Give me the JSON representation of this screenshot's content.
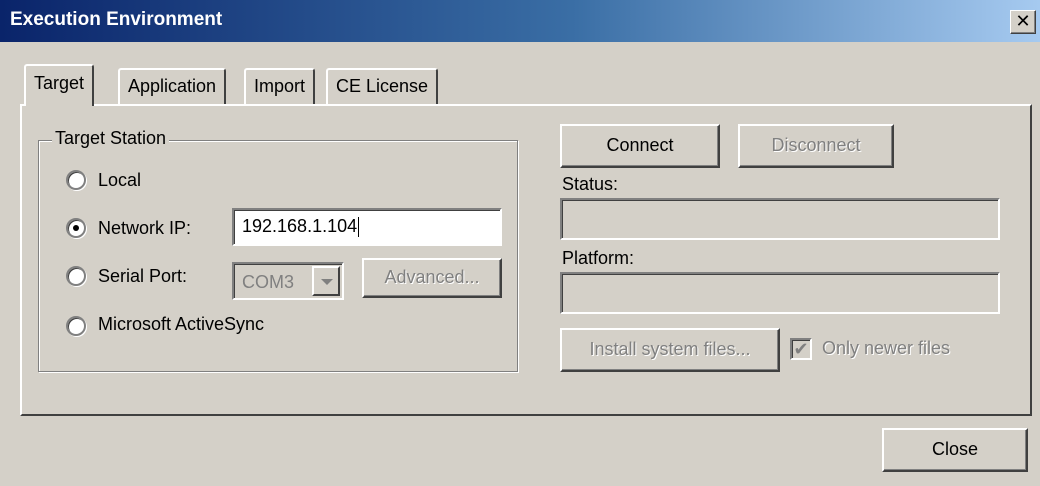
{
  "window": {
    "title": "Execution Environment",
    "close_glyph": "✕"
  },
  "tabs": [
    {
      "label": "Target",
      "active": true
    },
    {
      "label": "Application",
      "active": false
    },
    {
      "label": "Import",
      "active": false
    },
    {
      "label": "CE License",
      "active": false
    }
  ],
  "target_station": {
    "legend": "Target Station",
    "selected": "network_ip",
    "options": {
      "local": "Local",
      "network_ip": "Network IP:",
      "serial_port": "Serial Port:",
      "activesync": "Microsoft ActiveSync"
    },
    "ip_value": "192.168.1.104",
    "serial_port_value": "COM3",
    "advanced_label": "Advanced..."
  },
  "connection": {
    "connect_label": "Connect",
    "disconnect_label": "Disconnect",
    "status_label": "Status:",
    "status_value": "",
    "platform_label": "Platform:",
    "platform_value": "",
    "install_label": "Install system files...",
    "only_newer_label": "Only newer files",
    "only_newer_checked": true,
    "check_glyph": "✔"
  },
  "footer": {
    "close_label": "Close"
  },
  "icons": {
    "title_close": "close-icon",
    "combo_arrow": "chevron-down-icon"
  }
}
